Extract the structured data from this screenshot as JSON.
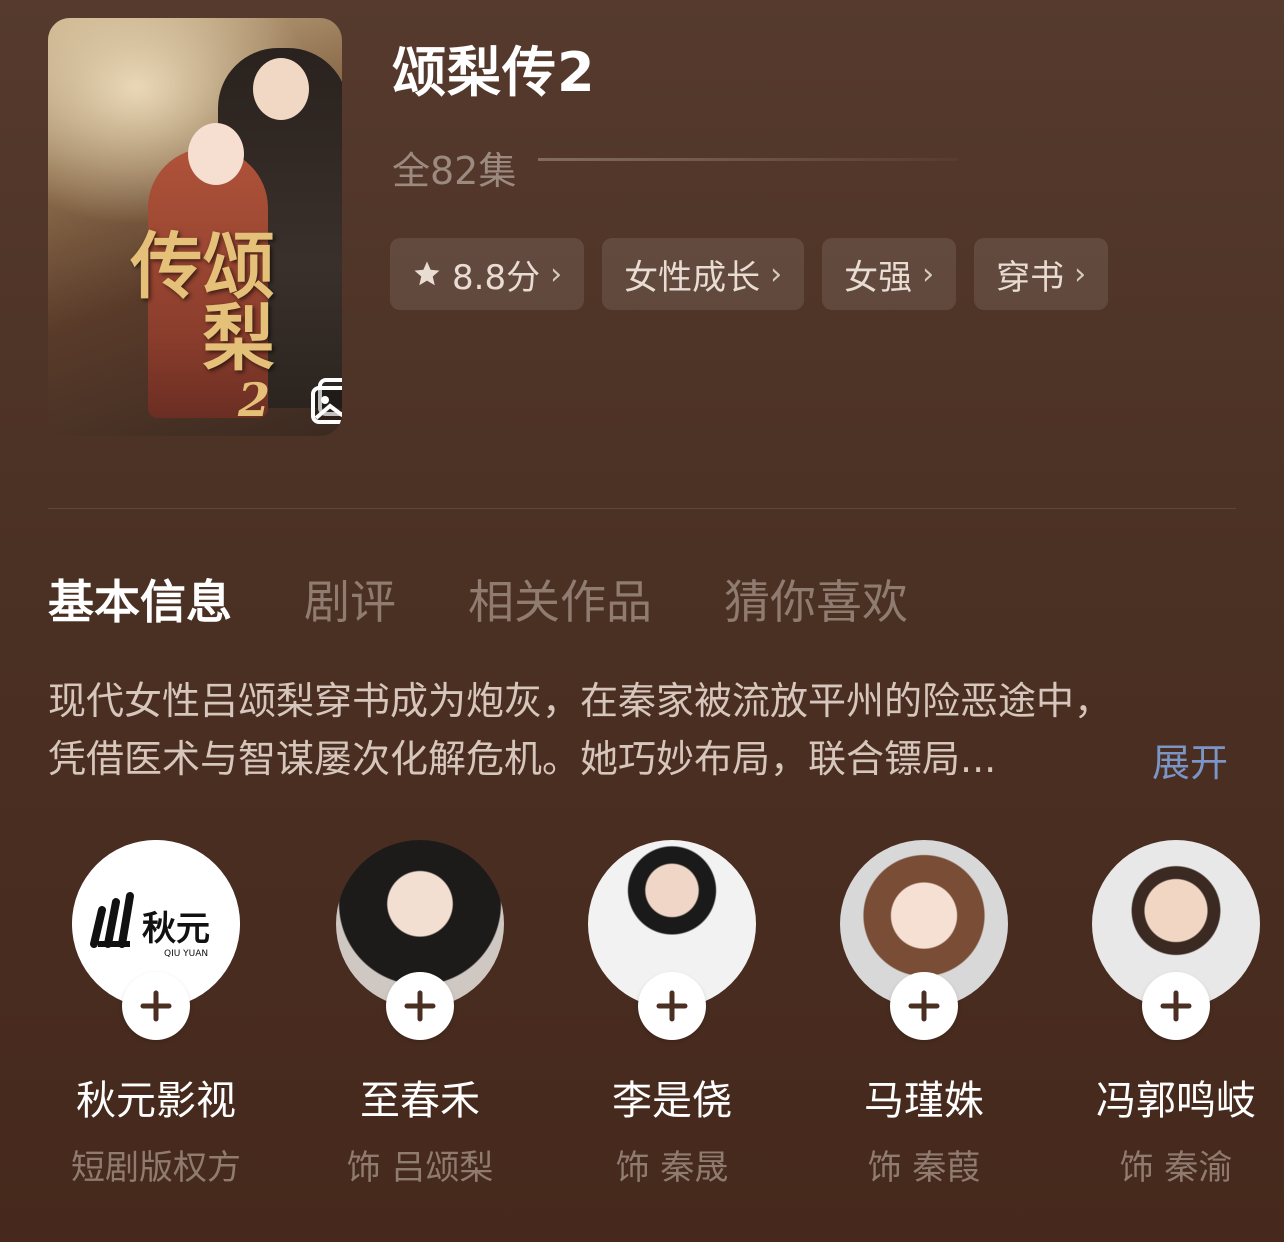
{
  "poster": {
    "calligraphy": "颂梨传",
    "number": "2"
  },
  "title": "颂梨传2",
  "episodes": "全82集",
  "tags": [
    {
      "label": "8.8分",
      "icon": "star-icon"
    },
    {
      "label": "女性成长"
    },
    {
      "label": "女强"
    },
    {
      "label": "穿书"
    }
  ],
  "tabs": [
    "基本信息",
    "剧评",
    "相关作品",
    "猜你喜欢"
  ],
  "description": {
    "line1": "现代女性吕颂梨穿书成为炮灰，在秦家被流放平州的险恶途中，",
    "line2": "凭借医术与智谋屡次化解危机。她巧妙布局，联合镖局...",
    "expand": "展开"
  },
  "cast": [
    {
      "name": "秋元影视",
      "role": "短剧版权方",
      "logo": "秋元",
      "logo_sub": "QIU YUAN"
    },
    {
      "name": "至春禾",
      "role": "饰 吕颂梨"
    },
    {
      "name": "李是侥",
      "role": "饰 秦晟"
    },
    {
      "name": "马瑾姝",
      "role": "饰 秦葭"
    },
    {
      "name": "冯郭鸣岐",
      "role": "饰 秦渝"
    }
  ],
  "colors": {
    "background": "#4a2f22",
    "expand_link": "#7a95c6",
    "muted_text": "#8f7b70"
  }
}
